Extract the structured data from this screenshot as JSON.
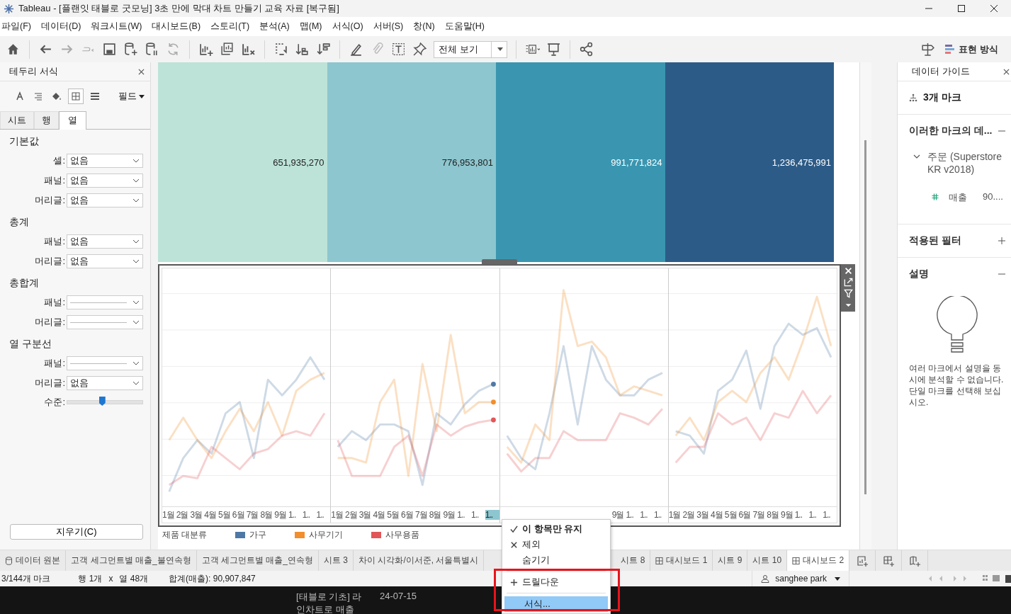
{
  "window": {
    "title": "Tableau - [플랜잇 태블로 굿모닝] 3초 만에 막대 차트 만들기 교육 자료 [복구됨]"
  },
  "menu": [
    "파일(F)",
    "데이터(D)",
    "워크시트(W)",
    "대시보드(B)",
    "스토리(T)",
    "분석(A)",
    "맵(M)",
    "서식(O)",
    "서버(S)",
    "창(N)",
    "도움말(H)"
  ],
  "toolbar": {
    "fit": "전체 보기",
    "show_me": "표현 방식"
  },
  "format_panel": {
    "title": "테두리 서식",
    "field_button": "필드",
    "tabs": [
      {
        "label": "시트",
        "selected": false
      },
      {
        "label": "행",
        "selected": false
      },
      {
        "label": "열",
        "selected": true
      }
    ],
    "sections": [
      {
        "title": "기본값",
        "rows": [
          {
            "label": "셀:",
            "kind": "text",
            "value": "없음"
          },
          {
            "label": "패널:",
            "kind": "text",
            "value": "없음"
          },
          {
            "label": "머리글:",
            "kind": "text",
            "value": "없음"
          }
        ]
      },
      {
        "title": "총계",
        "rows": [
          {
            "label": "패널:",
            "kind": "text",
            "value": "없음"
          },
          {
            "label": "머리글:",
            "kind": "text",
            "value": "없음"
          }
        ]
      },
      {
        "title": "총합계",
        "rows": [
          {
            "label": "패널:",
            "kind": "line"
          },
          {
            "label": "머리글:",
            "kind": "line"
          }
        ]
      },
      {
        "title": "열 구분선",
        "rows": [
          {
            "label": "패널:",
            "kind": "line"
          },
          {
            "label": "머리글:",
            "kind": "text",
            "value": "없음"
          },
          {
            "label": "수준:",
            "kind": "slider",
            "level": 0.47
          }
        ]
      }
    ],
    "clear_button": "지우기(C)"
  },
  "bar_blocks": [
    {
      "value": "651,935,270",
      "color": "#bde3d8"
    },
    {
      "value": "776,953,801",
      "color": "#8dc6cf"
    },
    {
      "value": "991,771,824",
      "color": "#3a96b0"
    },
    {
      "value": "1,236,475,991",
      "color": "#2d5b87"
    }
  ],
  "line_panels": [
    {
      "labels": [
        {
          "text": "1월",
          "selected": false
        },
        {
          "text": "2월",
          "selected": false
        },
        {
          "text": "3월",
          "selected": false
        },
        {
          "text": "4월",
          "selected": false
        },
        {
          "text": "5월",
          "selected": false
        },
        {
          "text": "6월",
          "selected": false
        },
        {
          "text": "7월",
          "selected": false
        },
        {
          "text": "8월",
          "selected": false
        },
        {
          "text": "9월",
          "selected": false
        },
        {
          "text": "1..",
          "selected": false
        },
        {
          "text": "1..",
          "selected": false
        },
        {
          "text": "1..",
          "selected": false
        }
      ]
    },
    {
      "labels": [
        {
          "text": "1월",
          "selected": false
        },
        {
          "text": "2월",
          "selected": false
        },
        {
          "text": "3월",
          "selected": false
        },
        {
          "text": "4월",
          "selected": false
        },
        {
          "text": "5월",
          "selected": false
        },
        {
          "text": "6월",
          "selected": false
        },
        {
          "text": "7월",
          "selected": false
        },
        {
          "text": "8월",
          "selected": false
        },
        {
          "text": "9월",
          "selected": false
        },
        {
          "text": "1..",
          "selected": false
        },
        {
          "text": "1..",
          "selected": false
        },
        {
          "text": "1..",
          "selected": true
        }
      ]
    },
    {
      "labels": [
        {
          "text": "9월",
          "selected": false
        },
        {
          "text": "1..",
          "selected": false
        },
        {
          "text": "1..",
          "selected": false
        },
        {
          "text": "1..",
          "selected": false
        }
      ]
    },
    {
      "labels": [
        {
          "text": "1월",
          "selected": false
        },
        {
          "text": "2월",
          "selected": false
        },
        {
          "text": "3월",
          "selected": false
        },
        {
          "text": "4월",
          "selected": false
        },
        {
          "text": "5월",
          "selected": false
        },
        {
          "text": "6월",
          "selected": false
        },
        {
          "text": "7월",
          "selected": false
        },
        {
          "text": "8월",
          "selected": false
        },
        {
          "text": "9월",
          "selected": false
        },
        {
          "text": "1..",
          "selected": false
        },
        {
          "text": "1..",
          "selected": false
        },
        {
          "text": "1..",
          "selected": false
        }
      ]
    }
  ],
  "legend": {
    "title": "제품 대분류",
    "items": [
      {
        "label": "가구",
        "color": "#4e79a7"
      },
      {
        "label": "사무기기",
        "color": "#f28e2b"
      },
      {
        "label": "사무용품",
        "color": "#e15759"
      }
    ]
  },
  "context_menu": {
    "annotated": true,
    "items": [
      {
        "label": "이 항목만 유지",
        "kind": "check",
        "selected": false
      },
      {
        "label": "제외",
        "kind": "cross",
        "selected": false
      },
      {
        "label": "숨기기",
        "kind": "plain",
        "selected": false
      },
      {
        "kind": "separator"
      },
      {
        "label": "드릴다운",
        "kind": "plus",
        "selected": false
      },
      {
        "kind": "separator"
      },
      {
        "label": "서식...",
        "kind": "plain",
        "selected": true
      }
    ]
  },
  "data_guide": {
    "title": "데이터 가이드",
    "marks": "3개 마크",
    "data_section": "이러한 마크의 데...",
    "source": "주문 (Superstore KR v2018)",
    "field": "매출",
    "field_value": "90....",
    "filters": "적용된 필터",
    "explain": "설명",
    "explain_text": "여러 마크에서 설명을 동시에 분석할 수 없습니다. 단일 마크를 선택해 보십시오."
  },
  "sheet_tabs": [
    {
      "label": "데이터 원본",
      "kind": "datasource",
      "selected": false
    },
    {
      "label": "고객 세그먼트별 매출_불연속형",
      "kind": "sheet",
      "selected": false
    },
    {
      "label": "고객 세그먼트별 매출_연속형",
      "kind": "sheet",
      "selected": false
    },
    {
      "label": "시트 3",
      "kind": "sheet",
      "selected": false
    },
    {
      "label": "차이 시각화/이서준, 서울특별시",
      "kind": "sheet",
      "selected": false
    },
    {
      "label": "시트 8",
      "kind": "sheet",
      "selected": false
    },
    {
      "label": "대시보드 1",
      "kind": "dashboard",
      "selected": false
    },
    {
      "label": "시트 9",
      "kind": "sheet",
      "selected": false
    },
    {
      "label": "시트 10",
      "kind": "sheet",
      "selected": false
    },
    {
      "label": "대시보드 2",
      "kind": "dashboard",
      "selected": true
    }
  ],
  "status_bar": {
    "marks": "3/144개 마크",
    "rows": "행 1개",
    "times": "x",
    "cols": "열 48개",
    "sum": "합계(매출): 90,907,847",
    "user": "sanghee park"
  },
  "background_window": {
    "title": "[태블로 기초] 라 인차트로 매출",
    "date": "24-07-15"
  }
}
